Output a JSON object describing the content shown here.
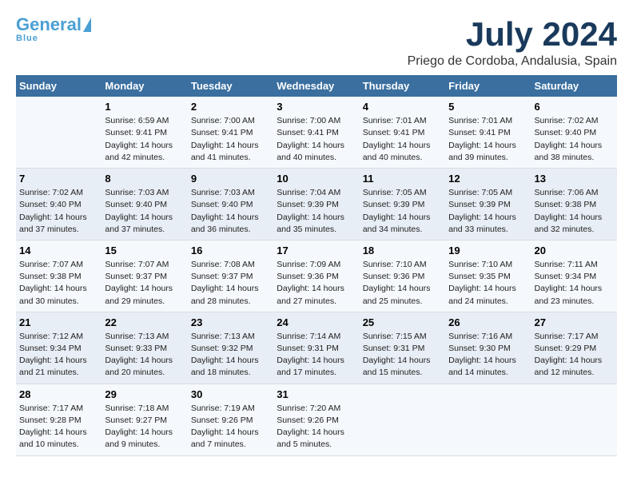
{
  "header": {
    "logo": {
      "general": "General",
      "blue": "Blue",
      "tagline": "BLUE"
    },
    "title": "July 2024",
    "location": "Priego de Cordoba, Andalusia, Spain"
  },
  "calendar": {
    "headers": [
      "Sunday",
      "Monday",
      "Tuesday",
      "Wednesday",
      "Thursday",
      "Friday",
      "Saturday"
    ],
    "weeks": [
      [
        {
          "day": "",
          "info": ""
        },
        {
          "day": "1",
          "info": "Sunrise: 6:59 AM\nSunset: 9:41 PM\nDaylight: 14 hours\nand 42 minutes."
        },
        {
          "day": "2",
          "info": "Sunrise: 7:00 AM\nSunset: 9:41 PM\nDaylight: 14 hours\nand 41 minutes."
        },
        {
          "day": "3",
          "info": "Sunrise: 7:00 AM\nSunset: 9:41 PM\nDaylight: 14 hours\nand 40 minutes."
        },
        {
          "day": "4",
          "info": "Sunrise: 7:01 AM\nSunset: 9:41 PM\nDaylight: 14 hours\nand 40 minutes."
        },
        {
          "day": "5",
          "info": "Sunrise: 7:01 AM\nSunset: 9:41 PM\nDaylight: 14 hours\nand 39 minutes."
        },
        {
          "day": "6",
          "info": "Sunrise: 7:02 AM\nSunset: 9:40 PM\nDaylight: 14 hours\nand 38 minutes."
        }
      ],
      [
        {
          "day": "7",
          "info": "Sunrise: 7:02 AM\nSunset: 9:40 PM\nDaylight: 14 hours\nand 37 minutes."
        },
        {
          "day": "8",
          "info": "Sunrise: 7:03 AM\nSunset: 9:40 PM\nDaylight: 14 hours\nand 37 minutes."
        },
        {
          "day": "9",
          "info": "Sunrise: 7:03 AM\nSunset: 9:40 PM\nDaylight: 14 hours\nand 36 minutes."
        },
        {
          "day": "10",
          "info": "Sunrise: 7:04 AM\nSunset: 9:39 PM\nDaylight: 14 hours\nand 35 minutes."
        },
        {
          "day": "11",
          "info": "Sunrise: 7:05 AM\nSunset: 9:39 PM\nDaylight: 14 hours\nand 34 minutes."
        },
        {
          "day": "12",
          "info": "Sunrise: 7:05 AM\nSunset: 9:39 PM\nDaylight: 14 hours\nand 33 minutes."
        },
        {
          "day": "13",
          "info": "Sunrise: 7:06 AM\nSunset: 9:38 PM\nDaylight: 14 hours\nand 32 minutes."
        }
      ],
      [
        {
          "day": "14",
          "info": "Sunrise: 7:07 AM\nSunset: 9:38 PM\nDaylight: 14 hours\nand 30 minutes."
        },
        {
          "day": "15",
          "info": "Sunrise: 7:07 AM\nSunset: 9:37 PM\nDaylight: 14 hours\nand 29 minutes."
        },
        {
          "day": "16",
          "info": "Sunrise: 7:08 AM\nSunset: 9:37 PM\nDaylight: 14 hours\nand 28 minutes."
        },
        {
          "day": "17",
          "info": "Sunrise: 7:09 AM\nSunset: 9:36 PM\nDaylight: 14 hours\nand 27 minutes."
        },
        {
          "day": "18",
          "info": "Sunrise: 7:10 AM\nSunset: 9:36 PM\nDaylight: 14 hours\nand 25 minutes."
        },
        {
          "day": "19",
          "info": "Sunrise: 7:10 AM\nSunset: 9:35 PM\nDaylight: 14 hours\nand 24 minutes."
        },
        {
          "day": "20",
          "info": "Sunrise: 7:11 AM\nSunset: 9:34 PM\nDaylight: 14 hours\nand 23 minutes."
        }
      ],
      [
        {
          "day": "21",
          "info": "Sunrise: 7:12 AM\nSunset: 9:34 PM\nDaylight: 14 hours\nand 21 minutes."
        },
        {
          "day": "22",
          "info": "Sunrise: 7:13 AM\nSunset: 9:33 PM\nDaylight: 14 hours\nand 20 minutes."
        },
        {
          "day": "23",
          "info": "Sunrise: 7:13 AM\nSunset: 9:32 PM\nDaylight: 14 hours\nand 18 minutes."
        },
        {
          "day": "24",
          "info": "Sunrise: 7:14 AM\nSunset: 9:31 PM\nDaylight: 14 hours\nand 17 minutes."
        },
        {
          "day": "25",
          "info": "Sunrise: 7:15 AM\nSunset: 9:31 PM\nDaylight: 14 hours\nand 15 minutes."
        },
        {
          "day": "26",
          "info": "Sunrise: 7:16 AM\nSunset: 9:30 PM\nDaylight: 14 hours\nand 14 minutes."
        },
        {
          "day": "27",
          "info": "Sunrise: 7:17 AM\nSunset: 9:29 PM\nDaylight: 14 hours\nand 12 minutes."
        }
      ],
      [
        {
          "day": "28",
          "info": "Sunrise: 7:17 AM\nSunset: 9:28 PM\nDaylight: 14 hours\nand 10 minutes."
        },
        {
          "day": "29",
          "info": "Sunrise: 7:18 AM\nSunset: 9:27 PM\nDaylight: 14 hours\nand 9 minutes."
        },
        {
          "day": "30",
          "info": "Sunrise: 7:19 AM\nSunset: 9:26 PM\nDaylight: 14 hours\nand 7 minutes."
        },
        {
          "day": "31",
          "info": "Sunrise: 7:20 AM\nSunset: 9:26 PM\nDaylight: 14 hours\nand 5 minutes."
        },
        {
          "day": "",
          "info": ""
        },
        {
          "day": "",
          "info": ""
        },
        {
          "day": "",
          "info": ""
        }
      ]
    ]
  }
}
